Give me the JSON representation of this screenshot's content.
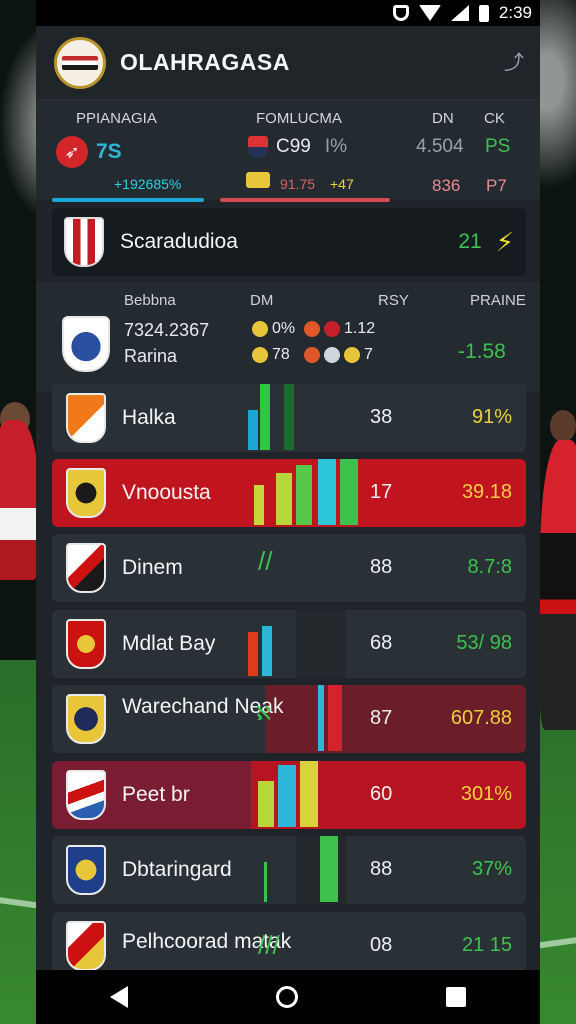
{
  "status_bar": {
    "time": "2:39"
  },
  "header": {
    "title": "OLAHRAGASA"
  },
  "summary": {
    "headers": [
      "PPIANAGIA",
      "FOMLUCMA",
      "DN",
      "CK"
    ],
    "row": {
      "a": "7S",
      "b": "C99",
      "b2": "I%",
      "c": "4.504",
      "d": "PS"
    },
    "bars": {
      "left": "+192685%",
      "mid1": "91.75",
      "mid2": "+47",
      "right1": "836",
      "right2": "P7"
    },
    "colors": {
      "accent_cyan": "#1aa7d6",
      "accent_red": "#d34a55"
    }
  },
  "featured": {
    "name": "Scaradudioa",
    "value": "21"
  },
  "summary2": {
    "headers": [
      "Bebbna",
      "DM",
      "RSY",
      "PRAINE"
    ],
    "line1": {
      "name": "7324.2367",
      "a": "0%",
      "b": "1.12"
    },
    "line2": {
      "name": "Rarina",
      "a": "78",
      "b": "7",
      "c": "-1.58"
    }
  },
  "teams": [
    {
      "name": "Halka",
      "num": "38",
      "pct": "91%",
      "pct_color": "#e8d33a",
      "style": "plain"
    },
    {
      "name": "Vnoousta",
      "num": "17",
      "pct": "39.18",
      "pct_color": "#f0d040",
      "style": "red"
    },
    {
      "name": "Dinem",
      "num": "88",
      "pct": "8.7:8",
      "pct_color": "#3cc24c",
      "style": "plain"
    },
    {
      "name": "Mdlat Bay",
      "num": "68",
      "pct": "53/ 98",
      "pct_color": "#3cc24c",
      "style": "plain"
    },
    {
      "name": "Warechand Neak",
      "num": "87",
      "pct": "607.88",
      "pct_color": "#e8d33a",
      "style": "maroon"
    },
    {
      "name": "Peet br",
      "num": "60",
      "pct": "301%",
      "pct_color": "#f0d040",
      "style": "maroon2"
    },
    {
      "name": "Dbtaringard",
      "num": "88",
      "pct": "37%",
      "pct_color": "#3cc24c",
      "style": "plain"
    },
    {
      "name": "Pelhcoorad matak",
      "num": "08",
      "pct": "21 15",
      "pct_color": "#3cc24c",
      "style": "plain"
    }
  ]
}
